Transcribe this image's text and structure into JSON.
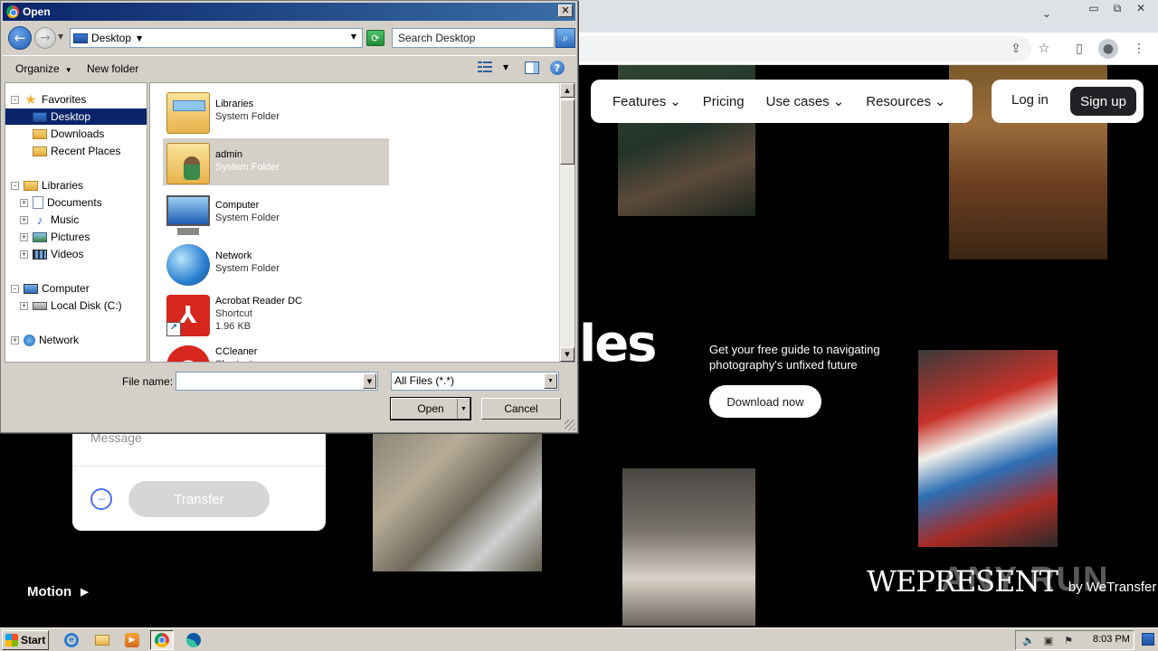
{
  "browser": {
    "window_controls": {
      "minimize": "▭",
      "restore": "⧉",
      "close": "✕"
    },
    "tab_dropdown": "⌄"
  },
  "website": {
    "nav": {
      "items": [
        {
          "label": "Features",
          "has_menu": true
        },
        {
          "label": "Pricing",
          "has_menu": false
        },
        {
          "label": "Use cases",
          "has_menu": true
        },
        {
          "label": "Resources",
          "has_menu": true
        }
      ],
      "login": "Log in",
      "signup": "Sign up"
    },
    "hero_fragment": "les",
    "guide_text": "Get your free guide to navigating photography's unfixed future",
    "download_button": "Download now",
    "transfer_card": {
      "message_placeholder": "Message",
      "more_glyph": "···",
      "transfer_button": "Transfer"
    },
    "motion_label": "Motion",
    "wepresent": {
      "logo": "WEPRESENT",
      "by": "by WeTransfer"
    },
    "watermark": "ANY RUN"
  },
  "dialog": {
    "title": "Open",
    "address": {
      "location": "Desktop"
    },
    "search_placeholder": "Search Desktop",
    "toolbar": {
      "organize": "Organize",
      "new_folder": "New folder"
    },
    "nav_tree": [
      {
        "label": "Favorites",
        "icon": "star-icon",
        "expander": "-"
      },
      {
        "label": "Desktop",
        "icon": "desktop-icon",
        "selected": true
      },
      {
        "label": "Downloads",
        "icon": "downloads-folder-icon"
      },
      {
        "label": "Recent Places",
        "icon": "recent-places-icon"
      },
      {
        "label": "Libraries",
        "icon": "libraries-icon",
        "expander": "-"
      },
      {
        "label": "Documents",
        "icon": "documents-icon",
        "expander": "+"
      },
      {
        "label": "Music",
        "icon": "music-icon",
        "expander": "+"
      },
      {
        "label": "Pictures",
        "icon": "pictures-icon",
        "expander": "+"
      },
      {
        "label": "Videos",
        "icon": "videos-icon",
        "expander": "+"
      },
      {
        "label": "Computer",
        "icon": "computer-icon",
        "expander": "-"
      },
      {
        "label": "Local Disk (C:)",
        "icon": "local-disk-icon",
        "expander": "+"
      },
      {
        "label": "Network",
        "icon": "network-icon",
        "expander": "+"
      }
    ],
    "files": [
      {
        "name": "Libraries",
        "type": "System Folder",
        "icon": "libraries-folder-icon"
      },
      {
        "name": "admin",
        "type": "System Folder",
        "icon": "user-folder-icon",
        "selected": true
      },
      {
        "name": "Computer",
        "type": "System Folder",
        "icon": "computer-icon"
      },
      {
        "name": "Network",
        "type": "System Folder",
        "icon": "network-globe-icon"
      },
      {
        "name": "Acrobat Reader DC",
        "type": "Shortcut",
        "size": "1.96 KB",
        "icon": "acrobat-reader-icon"
      },
      {
        "name": "CCleaner",
        "type": "Shortcut",
        "icon": "ccleaner-icon"
      }
    ],
    "file_name_label": "File name:",
    "file_name_value": "",
    "file_type": "All Files (*.*)",
    "open_button": "Open",
    "cancel_button": "Cancel"
  },
  "taskbar": {
    "start": "Start",
    "apps": [
      {
        "name": "internet-explorer-icon"
      },
      {
        "name": "file-explorer-icon"
      },
      {
        "name": "media-player-icon"
      },
      {
        "name": "chrome-icon",
        "active": true
      },
      {
        "name": "edge-icon"
      }
    ],
    "clock": "8:03 PM"
  }
}
